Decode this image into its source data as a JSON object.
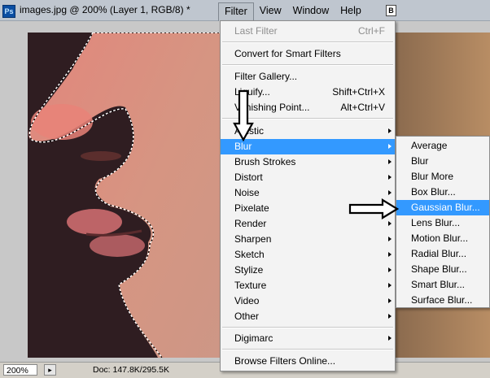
{
  "window": {
    "app_icon": "Ps",
    "title": "images.jpg @ 200% (Layer 1, RGB/8) *",
    "b_icon": "B"
  },
  "menubar": [
    "Filter",
    "View",
    "Window",
    "Help"
  ],
  "status": {
    "zoom": "200%",
    "doc": "Doc: 147.8K/295.5K"
  },
  "filter_menu": {
    "items": [
      {
        "label": "Last Filter",
        "shortcut": "Ctrl+F",
        "disabled": true
      },
      {
        "label": "Convert for Smart Filters"
      },
      {
        "label": "Filter Gallery..."
      },
      {
        "label": "Liquify...",
        "shortcut": "Shift+Ctrl+X"
      },
      {
        "label": "Vanishing Point...",
        "shortcut": "Alt+Ctrl+V"
      },
      {
        "label": "Artistic",
        "submenu": true
      },
      {
        "label": "Blur",
        "submenu": true,
        "highlighted": true
      },
      {
        "label": "Brush Strokes",
        "submenu": true
      },
      {
        "label": "Distort",
        "submenu": true
      },
      {
        "label": "Noise",
        "submenu": true
      },
      {
        "label": "Pixelate",
        "submenu": true
      },
      {
        "label": "Render",
        "submenu": true
      },
      {
        "label": "Sharpen",
        "submenu": true
      },
      {
        "label": "Sketch",
        "submenu": true
      },
      {
        "label": "Stylize",
        "submenu": true
      },
      {
        "label": "Texture",
        "submenu": true
      },
      {
        "label": "Video",
        "submenu": true
      },
      {
        "label": "Other",
        "submenu": true
      },
      {
        "label": "Digimarc",
        "submenu": true
      },
      {
        "label": "Browse Filters Online..."
      }
    ]
  },
  "blur_menu": {
    "items": [
      {
        "label": "Average"
      },
      {
        "label": "Blur"
      },
      {
        "label": "Blur More"
      },
      {
        "label": "Box Blur..."
      },
      {
        "label": "Gaussian Blur...",
        "highlighted": true
      },
      {
        "label": "Lens Blur..."
      },
      {
        "label": "Motion Blur..."
      },
      {
        "label": "Radial Blur..."
      },
      {
        "label": "Shape Blur..."
      },
      {
        "label": "Smart Blur..."
      },
      {
        "label": "Surface Blur..."
      }
    ]
  },
  "colors": {
    "highlight": "#3399ff",
    "menu_bg": "#f3f3f3",
    "title_bar": "#bfc6cf"
  }
}
